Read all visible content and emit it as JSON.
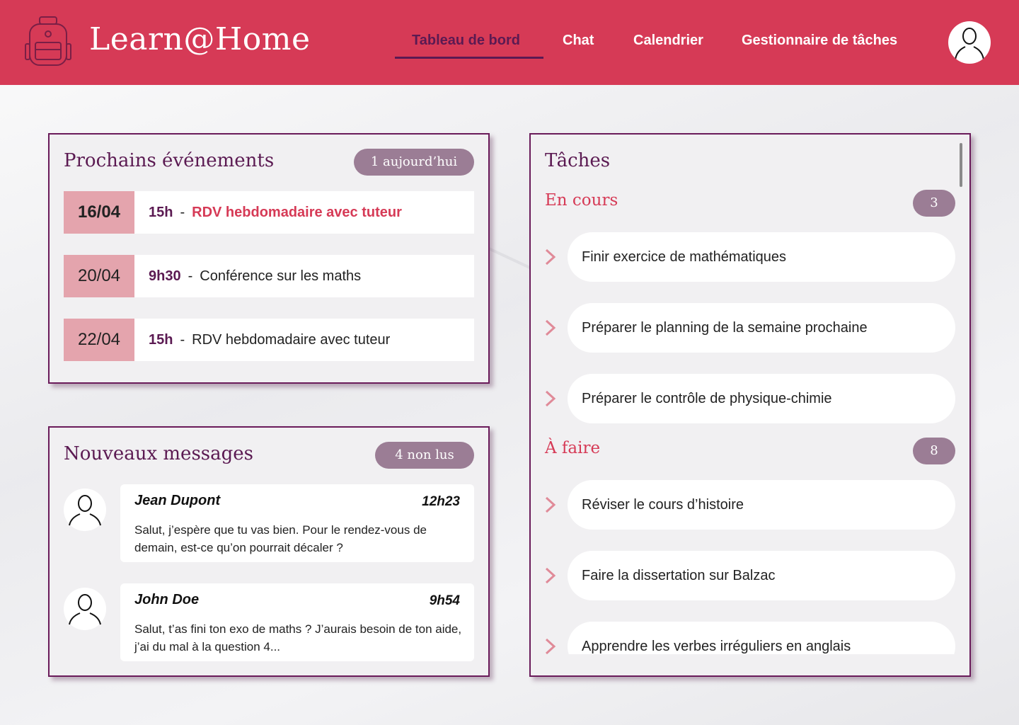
{
  "app": {
    "title": "Learn@Home"
  },
  "nav": {
    "items": [
      {
        "label": "Tableau de bord",
        "active": true
      },
      {
        "label": "Chat",
        "active": false
      },
      {
        "label": "Calendrier",
        "active": false
      },
      {
        "label": "Gestionnaire de tâches",
        "active": false
      }
    ]
  },
  "icons": {
    "logo": "backpack-icon",
    "profile": "user-avatar-icon",
    "task_chevron": "chevron-right-icon"
  },
  "colors": {
    "header": "#d63a56",
    "primary": "#5b1a52",
    "pill": "#9b7d95",
    "date_badge": "#e4a4ad",
    "accent": "#d63a56"
  },
  "events": {
    "title": "Prochains événements",
    "badge": "1 aujourd’hui",
    "items": [
      {
        "date": "16/04",
        "time": "15h",
        "separator": "-",
        "title": "RDV hebdomadaire avec tuteur",
        "today": true
      },
      {
        "date": "20/04",
        "time": "9h30",
        "separator": "-",
        "title": "Conférence sur les maths",
        "today": false
      },
      {
        "date": "22/04",
        "time": "15h",
        "separator": "-",
        "title": "RDV hebdomadaire avec tuteur",
        "today": false
      }
    ]
  },
  "messages": {
    "title": "Nouveaux messages",
    "badge": "4 non lus",
    "items": [
      {
        "name": "Jean Dupont",
        "time": "12h23",
        "body": "Salut, j’espère que tu vas bien. Pour le rendez-vous de demain, est-ce qu’on pourrait décaler ?"
      },
      {
        "name": "John Doe",
        "time": "9h54",
        "body": "Salut, t’as fini ton exo de maths ? J’aurais besoin de ton aide, j’ai du mal à la question 4..."
      }
    ]
  },
  "tasks": {
    "title": "Tâches",
    "sections": [
      {
        "title": "En cours",
        "count": "3",
        "items": [
          "Finir exercice de mathématiques",
          "Préparer le planning de la semaine prochaine",
          "Préparer le contrôle de physique-chimie"
        ]
      },
      {
        "title": "À faire",
        "count": "8",
        "items": [
          "Réviser le cours d’histoire",
          "Faire la dissertation sur Balzac",
          "Apprendre les verbes irréguliers en anglais"
        ]
      }
    ]
  }
}
